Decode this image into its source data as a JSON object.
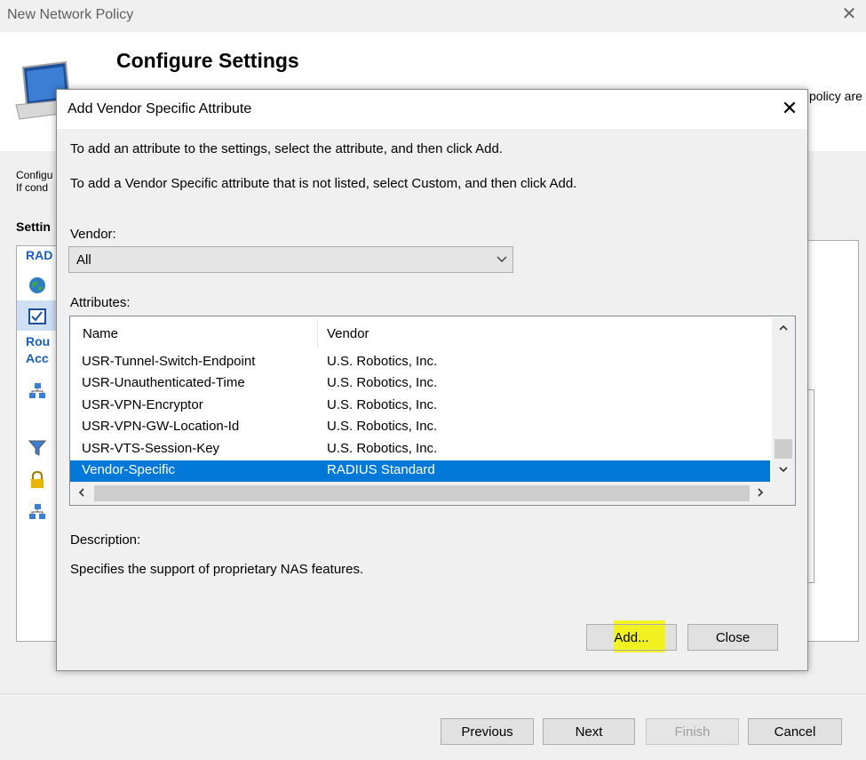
{
  "background_window": {
    "title": "New Network Policy",
    "header_title": "Configure Settings",
    "header_desc_fragment": "policy are",
    "intro_line1": "Configu",
    "intro_line2": "If cond",
    "settings_label": "Settin",
    "items": [
      "RAD",
      "Rou",
      "Acc"
    ],
    "buttons": {
      "previous": "Previous",
      "next": "Next",
      "finish": "Finish",
      "cancel": "Cancel"
    }
  },
  "dialog": {
    "title": "Add Vendor Specific Attribute",
    "instruction1": "To add an attribute to the settings, select the attribute, and then click Add.",
    "instruction2": "To add a Vendor Specific attribute that is not listed, select Custom, and then click Add.",
    "vendor_label": "Vendor:",
    "vendor_value": "All",
    "attributes_label": "Attributes:",
    "columns": {
      "name": "Name",
      "vendor": "Vendor"
    },
    "rows": [
      {
        "name": "USR-Tunnel-Switch-Endpoint",
        "vendor": "U.S. Robotics, Inc."
      },
      {
        "name": "USR-Unauthenticated-Time",
        "vendor": "U.S. Robotics, Inc."
      },
      {
        "name": "USR-VPN-Encryptor",
        "vendor": "U.S. Robotics, Inc."
      },
      {
        "name": "USR-VPN-GW-Location-Id",
        "vendor": "U.S. Robotics, Inc."
      },
      {
        "name": "USR-VTS-Session-Key",
        "vendor": "U.S. Robotics, Inc."
      },
      {
        "name": "Vendor-Specific",
        "vendor": "RADIUS Standard"
      }
    ],
    "selected_row": 5,
    "description_label": "Description:",
    "description_text": "Specifies the support of proprietary NAS features.",
    "buttons": {
      "add": "Add...",
      "close": "Close"
    }
  },
  "colors": {
    "selection": "#0078d7",
    "highlight": "#f5f500",
    "link": "#1a5fb4"
  },
  "icons": [
    "close-icon",
    "computer-icon",
    "globe-icon",
    "checklist-icon",
    "network-icon",
    "filter-icon",
    "lock-icon",
    "chevron-down-icon"
  ]
}
